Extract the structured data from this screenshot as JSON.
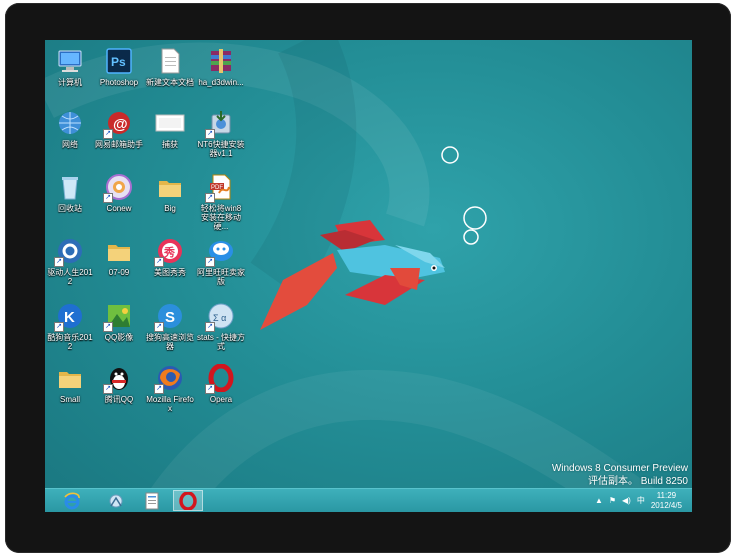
{
  "desktop": {
    "icons": [
      {
        "label": "计算机",
        "icon": "computer-icon"
      },
      {
        "label": "Photoshop",
        "icon": "photoshop-icon"
      },
      {
        "label": "新建文本文档",
        "icon": "text-document-icon"
      },
      {
        "label": "ha_d3dwin...",
        "icon": "archive-icon"
      },
      {
        "label": "网络",
        "icon": "network-icon"
      },
      {
        "label": "网易邮箱助手",
        "icon": "mail-assistant-icon"
      },
      {
        "label": "捕获",
        "icon": "image-file-icon"
      },
      {
        "label": "NT6快捷安装器v1.1",
        "icon": "installer-icon"
      },
      {
        "label": "回收站",
        "icon": "recycle-bin-icon"
      },
      {
        "label": "Conew",
        "icon": "conew-icon"
      },
      {
        "label": "Big",
        "icon": "folder-icon"
      },
      {
        "label": "轻松将win8安装在移动硬...",
        "icon": "pdf-icon"
      },
      {
        "label": "驱动人生2012",
        "icon": "driver-icon"
      },
      {
        "label": "07-09",
        "icon": "folder-icon"
      },
      {
        "label": "美图秀秀",
        "icon": "meitu-icon"
      },
      {
        "label": "阿里旺旺卖家版",
        "icon": "aliwangwang-icon"
      },
      {
        "label": "酷狗音乐2012",
        "icon": "kugou-icon"
      },
      {
        "label": "QQ影像",
        "icon": "qq-image-icon"
      },
      {
        "label": "搜狗高速浏览器",
        "icon": "sogou-browser-icon"
      },
      {
        "label": "stats - 快捷方式",
        "icon": "stats-shortcut-icon"
      },
      {
        "label": "Small",
        "icon": "folder-icon"
      },
      {
        "label": "腾讯QQ",
        "icon": "qq-icon"
      },
      {
        "label": "Mozilla Firefox",
        "icon": "firefox-icon"
      },
      {
        "label": "Opera",
        "icon": "opera-icon"
      }
    ],
    "watermark": {
      "line1": "Windows 8 Consumer Preview",
      "line2": "评估副本。 Build 8250"
    }
  },
  "taskbar": {
    "items": [
      {
        "icon": "ie-icon"
      },
      {
        "icon": "explorer-icon"
      },
      {
        "icon": "document-icon"
      },
      {
        "icon": "opera-icon"
      }
    ],
    "tray": {
      "arrow": "▲",
      "flag": "⚑",
      "volume": "◀)",
      "ime": "中",
      "time": "11:29",
      "date": "2012/4/5"
    }
  },
  "colors": {
    "background": "#238e96",
    "taskbar": "#34a5b0",
    "fish_body": "#4fc3e0",
    "fish_fin": "#e24a3b"
  }
}
